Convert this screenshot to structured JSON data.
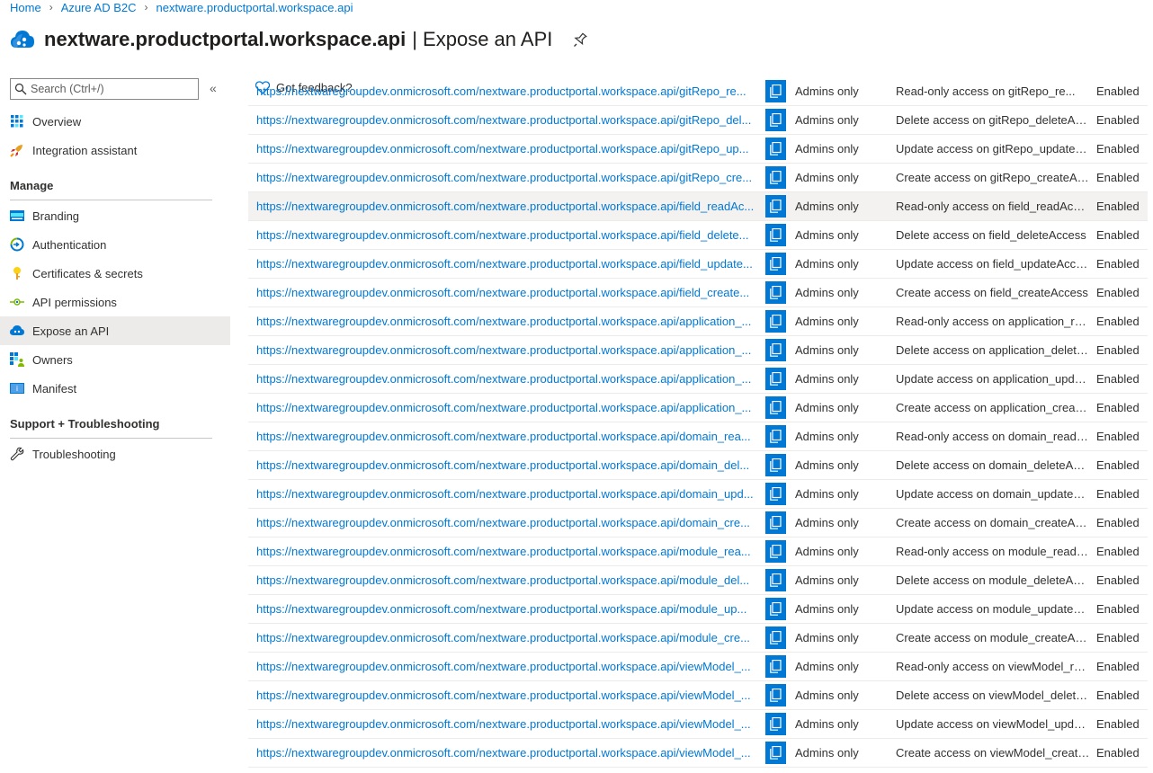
{
  "breadcrumb": {
    "items": [
      "Home",
      "Azure AD B2C",
      "nextware.productportal.workspace.api"
    ]
  },
  "header": {
    "title": "nextware.productportal.workspace.api",
    "subtitle": "| Expose an API",
    "icon": "cloud-app-icon"
  },
  "sidebar": {
    "search_placeholder": "Search (Ctrl+/)",
    "collapse_glyph": "«",
    "items_top": [
      {
        "label": "Overview",
        "icon": "grid-icon"
      },
      {
        "label": "Integration assistant",
        "icon": "rocket-icon"
      }
    ],
    "manage_heading": "Manage",
    "items_manage": [
      {
        "label": "Branding",
        "icon": "branding-icon"
      },
      {
        "label": "Authentication",
        "icon": "authentication-icon"
      },
      {
        "label": "Certificates & secrets",
        "icon": "key-icon"
      },
      {
        "label": "API permissions",
        "icon": "api-permissions-icon"
      },
      {
        "label": "Expose an API",
        "icon": "cloud-icon",
        "active": true
      },
      {
        "label": "Owners",
        "icon": "owners-icon"
      },
      {
        "label": "Manifest",
        "icon": "manifest-icon"
      }
    ],
    "support_heading": "Support + Troubleshooting",
    "items_support": [
      {
        "label": "Troubleshooting",
        "icon": "wrench-icon"
      }
    ]
  },
  "content": {
    "feedback_label": "Got feedback?",
    "partial_row": {
      "uri": "https://nextwaregroupdev.onmicrosoft.com/nextware.productportal.workspace.api/gitRepo_re...",
      "who": "Admins only",
      "desc": "Read-only access on gitRepo_re...",
      "state": "Enabled"
    },
    "rows": [
      {
        "uri": "https://nextwaregroupdev.onmicrosoft.com/nextware.productportal.workspace.api/gitRepo_del...",
        "who": "Admins only",
        "desc": "Delete access on gitRepo_deleteAcc...",
        "state": "Enabled"
      },
      {
        "uri": "https://nextwaregroupdev.onmicrosoft.com/nextware.productportal.workspace.api/gitRepo_up...",
        "who": "Admins only",
        "desc": "Update access on gitRepo_updateA...",
        "state": "Enabled"
      },
      {
        "uri": "https://nextwaregroupdev.onmicrosoft.com/nextware.productportal.workspace.api/gitRepo_cre...",
        "who": "Admins only",
        "desc": "Create access on gitRepo_createAcc...",
        "state": "Enabled"
      },
      {
        "uri": "https://nextwaregroupdev.onmicrosoft.com/nextware.productportal.workspace.api/field_readAc...",
        "who": "Admins only",
        "desc": "Read-only access on field_readAccess",
        "state": "Enabled",
        "highlight": true
      },
      {
        "uri": "https://nextwaregroupdev.onmicrosoft.com/nextware.productportal.workspace.api/field_delete...",
        "who": "Admins only",
        "desc": "Delete access on field_deleteAccess",
        "state": "Enabled"
      },
      {
        "uri": "https://nextwaregroupdev.onmicrosoft.com/nextware.productportal.workspace.api/field_update...",
        "who": "Admins only",
        "desc": "Update access on field_updateAccess",
        "state": "Enabled"
      },
      {
        "uri": "https://nextwaregroupdev.onmicrosoft.com/nextware.productportal.workspace.api/field_create...",
        "who": "Admins only",
        "desc": "Create access on field_createAccess",
        "state": "Enabled"
      },
      {
        "uri": "https://nextwaregroupdev.onmicrosoft.com/nextware.productportal.workspace.api/application_...",
        "who": "Admins only",
        "desc": "Read-only access on application_re...",
        "state": "Enabled"
      },
      {
        "uri": "https://nextwaregroupdev.onmicrosoft.com/nextware.productportal.workspace.api/application_...",
        "who": "Admins only",
        "desc": "Delete access on application_delete...",
        "state": "Enabled"
      },
      {
        "uri": "https://nextwaregroupdev.onmicrosoft.com/nextware.productportal.workspace.api/application_...",
        "who": "Admins only",
        "desc": "Update access on application_upda...",
        "state": "Enabled"
      },
      {
        "uri": "https://nextwaregroupdev.onmicrosoft.com/nextware.productportal.workspace.api/application_...",
        "who": "Admins only",
        "desc": "Create access on application_create...",
        "state": "Enabled"
      },
      {
        "uri": "https://nextwaregroupdev.onmicrosoft.com/nextware.productportal.workspace.api/domain_rea...",
        "who": "Admins only",
        "desc": "Read-only access on domain_readA...",
        "state": "Enabled"
      },
      {
        "uri": "https://nextwaregroupdev.onmicrosoft.com/nextware.productportal.workspace.api/domain_del...",
        "who": "Admins only",
        "desc": "Delete access on domain_deleteAcc...",
        "state": "Enabled"
      },
      {
        "uri": "https://nextwaregroupdev.onmicrosoft.com/nextware.productportal.workspace.api/domain_upd...",
        "who": "Admins only",
        "desc": "Update access on domain_updateA...",
        "state": "Enabled"
      },
      {
        "uri": "https://nextwaregroupdev.onmicrosoft.com/nextware.productportal.workspace.api/domain_cre...",
        "who": "Admins only",
        "desc": "Create access on domain_createAcc...",
        "state": "Enabled"
      },
      {
        "uri": "https://nextwaregroupdev.onmicrosoft.com/nextware.productportal.workspace.api/module_rea...",
        "who": "Admins only",
        "desc": "Read-only access on module_readA...",
        "state": "Enabled"
      },
      {
        "uri": "https://nextwaregroupdev.onmicrosoft.com/nextware.productportal.workspace.api/module_del...",
        "who": "Admins only",
        "desc": "Delete access on module_deleteAcc...",
        "state": "Enabled"
      },
      {
        "uri": "https://nextwaregroupdev.onmicrosoft.com/nextware.productportal.workspace.api/module_up...",
        "who": "Admins only",
        "desc": "Update access on module_updateA...",
        "state": "Enabled"
      },
      {
        "uri": "https://nextwaregroupdev.onmicrosoft.com/nextware.productportal.workspace.api/module_cre...",
        "who": "Admins only",
        "desc": "Create access on module_createAcc...",
        "state": "Enabled"
      },
      {
        "uri": "https://nextwaregroupdev.onmicrosoft.com/nextware.productportal.workspace.api/viewModel_...",
        "who": "Admins only",
        "desc": "Read-only access on viewModel_re...",
        "state": "Enabled"
      },
      {
        "uri": "https://nextwaregroupdev.onmicrosoft.com/nextware.productportal.workspace.api/viewModel_...",
        "who": "Admins only",
        "desc": "Delete access on viewModel_delete...",
        "state": "Enabled"
      },
      {
        "uri": "https://nextwaregroupdev.onmicrosoft.com/nextware.productportal.workspace.api/viewModel_...",
        "who": "Admins only",
        "desc": "Update access on viewModel_upda...",
        "state": "Enabled"
      },
      {
        "uri": "https://nextwaregroupdev.onmicrosoft.com/nextware.productportal.workspace.api/viewModel_...",
        "who": "Admins only",
        "desc": "Create access on viewModel_create...",
        "state": "Enabled"
      }
    ]
  },
  "colors": {
    "accent": "#0078d4",
    "active_bg": "#edebe9",
    "row_highlight": "#f3f2f1"
  }
}
